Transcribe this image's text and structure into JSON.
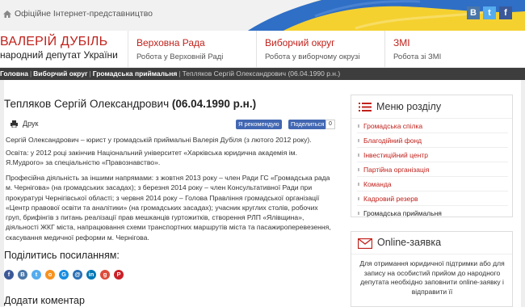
{
  "topbar": {
    "home_text": "Офіційне Інтернет-представництво",
    "social": {
      "vk": "В",
      "twitter": "t",
      "facebook": "f"
    }
  },
  "header": {
    "brand_name": "ВАЛЕРІЙ ДУБІЛЬ",
    "brand_subtitle": "народний депутат України",
    "nav": [
      {
        "title": "Верховна Рада",
        "subtitle": "Робота у Верховній Раді"
      },
      {
        "title": "Виборчий округ",
        "subtitle": "Робота у виборчому окрузі"
      },
      {
        "title": "ЗМІ",
        "subtitle": "Робота зі ЗМІ"
      }
    ]
  },
  "breadcrumbs": {
    "items": [
      "Головна",
      "Виборчий округ",
      "Громадська приймальня"
    ],
    "current": "Тепляков Сергій Олександрович (06.04.1990 р.н.)"
  },
  "article": {
    "title_main": "Тепляков Сергій Олександрович",
    "title_date": "(06.04.1990 р.н.)",
    "print_label": "Друк",
    "fb_like": "Я рекомендую",
    "fb_share": "Поделиться",
    "fb_count": "0",
    "p1": "Сергій Олександрович – юрист у громадській приймальні  Валерія Дубіля (з лютого 2012 року).",
    "p2": "Освіта: у 2012 році закінчив Національний університет «Харківська юридична академія ім. Я.Мудрого» за спеціальністю «Правознавство».",
    "p3": "Професійна діяльність за іншими напрямами: з жовтня 2013 року – член Ради ГС «Громадська рада м. Чернігова» (на громадських засадах); з березня 2014 року – член Консультативної Ради при прокуратурі Чернігівської області; з червня 2014 року – Голова Правління громадської організації «Центр правової освіти та аналітики» (на громадських засадах); учасник круглих столів, робочих груп, брифінгів з питань реалізації прав мешканців гуртожитків, створення РЛП «Ялівщина», діяльності ЖКГ міста, напрацювання схеми транспортних маршрутів міста та пасажироперевезення, скасування медичної реформи м. Чернігова.",
    "share_title": "Поділитись посиланням:",
    "share_icons": [
      "f",
      "В",
      "t",
      "o",
      "G",
      "@",
      "in",
      "g",
      "P"
    ],
    "comment_title": "Додати коментар"
  },
  "menu": {
    "title": "Меню розділу",
    "items": [
      "Громадська спілка",
      "Благодійний фонд",
      "Інвестиційний центр",
      "Партійна організація",
      "Команда",
      "Кадровий резерв",
      "Громадська приймальня"
    ]
  },
  "online_form": {
    "title": "Online-заявка",
    "text": "Для отримання юридичної підтримки або для запису на особистий прийом до народного депутата необхідно заповнити online-заявку і відправити її"
  },
  "colors": {
    "accent": "#c0211b",
    "breadcrumb_bg": "#3d3d3d",
    "facebook": "#3b5998",
    "vk": "#4a76a8",
    "twitter": "#55acee"
  }
}
